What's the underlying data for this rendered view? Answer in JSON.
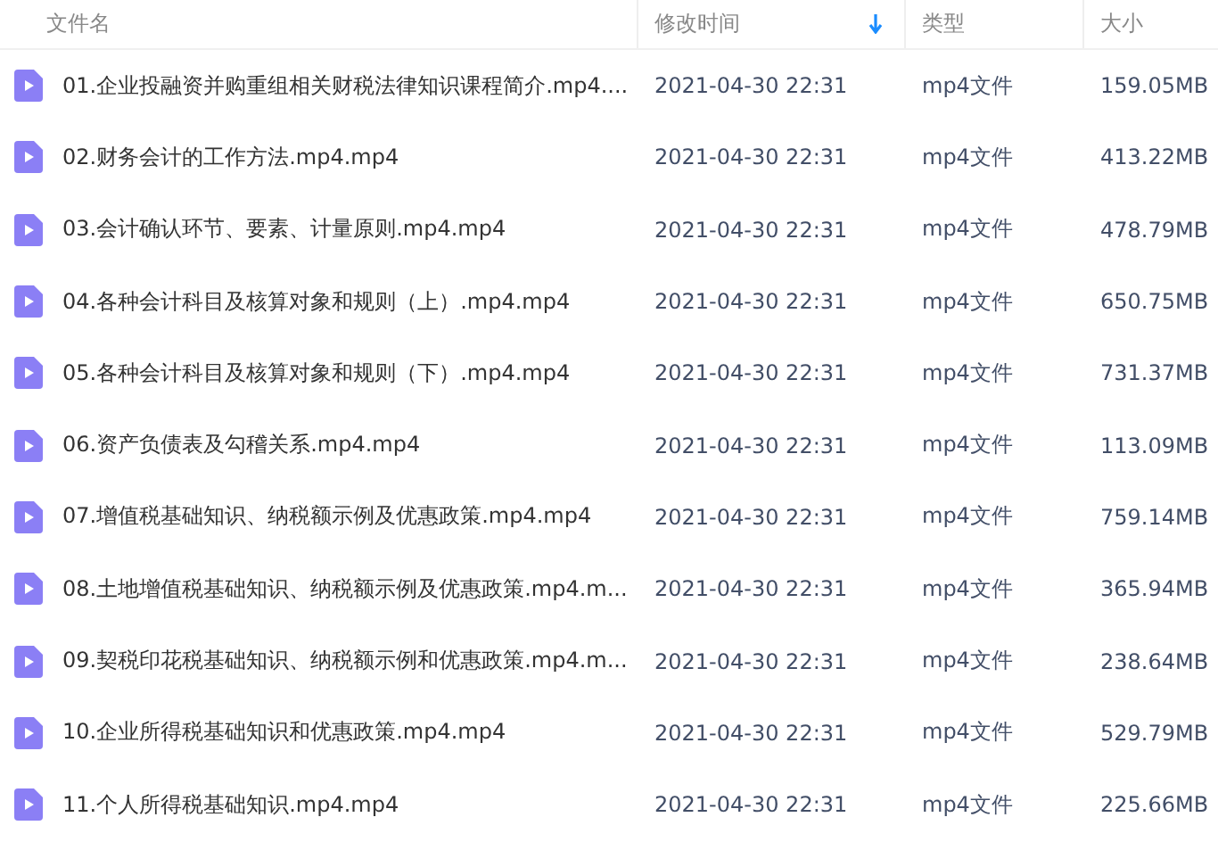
{
  "table": {
    "columns": [
      {
        "label": "文件名",
        "sorted": false
      },
      {
        "label": "修改时间",
        "sorted": true
      },
      {
        "label": "类型",
        "sorted": false
      },
      {
        "label": "大小",
        "sorted": false
      }
    ],
    "rows": [
      {
        "name": "01.企业投融资并购重组相关财税法律知识课程简介.mp4....",
        "modified": "2021-04-30 22:31",
        "type": "mp4文件",
        "size": "159.05MB"
      },
      {
        "name": "02.财务会计的工作方法.mp4.mp4",
        "modified": "2021-04-30 22:31",
        "type": "mp4文件",
        "size": "413.22MB"
      },
      {
        "name": "03.会计确认环节、要素、计量原则.mp4.mp4",
        "modified": "2021-04-30 22:31",
        "type": "mp4文件",
        "size": "478.79MB"
      },
      {
        "name": "04.各种会计科目及核算对象和规则（上）.mp4.mp4",
        "modified": "2021-04-30 22:31",
        "type": "mp4文件",
        "size": "650.75MB"
      },
      {
        "name": "05.各种会计科目及核算对象和规则（下）.mp4.mp4",
        "modified": "2021-04-30 22:31",
        "type": "mp4文件",
        "size": "731.37MB"
      },
      {
        "name": "06.资产负债表及勾稽关系.mp4.mp4",
        "modified": "2021-04-30 22:31",
        "type": "mp4文件",
        "size": "113.09MB"
      },
      {
        "name": "07.增值税基础知识、纳税额示例及优惠政策.mp4.mp4",
        "modified": "2021-04-30 22:31",
        "type": "mp4文件",
        "size": "759.14MB"
      },
      {
        "name": "08.土地增值税基础知识、纳税额示例及优惠政策.mp4.m...",
        "modified": "2021-04-30 22:31",
        "type": "mp4文件",
        "size": "365.94MB"
      },
      {
        "name": "09.契税印花税基础知识、纳税额示例和优惠政策.mp4.m...",
        "modified": "2021-04-30 22:31",
        "type": "mp4文件",
        "size": "238.64MB"
      },
      {
        "name": "10.企业所得税基础知识和优惠政策.mp4.mp4",
        "modified": "2021-04-30 22:31",
        "type": "mp4文件",
        "size": "529.79MB"
      },
      {
        "name": "11.个人所得税基础知识.mp4.mp4",
        "modified": "2021-04-30 22:31",
        "type": "mp4文件",
        "size": "225.66MB"
      }
    ]
  }
}
